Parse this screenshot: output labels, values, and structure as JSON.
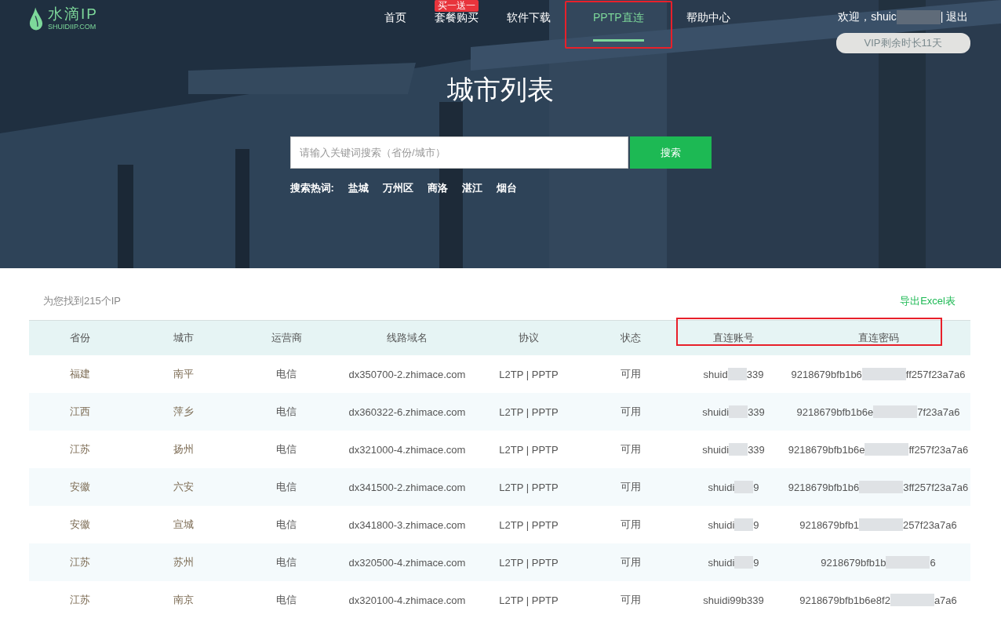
{
  "logo": {
    "name": "水滴IP",
    "domain": "SHUIDIIP.COM"
  },
  "nav": [
    {
      "label": "首页",
      "selected": false
    },
    {
      "label": "套餐购买",
      "selected": false,
      "badge": "买一送一"
    },
    {
      "label": "软件下载",
      "selected": false
    },
    {
      "label": "PPTP直连",
      "selected": true,
      "highlighted": true
    },
    {
      "label": "帮助中心",
      "selected": false
    }
  ],
  "user": {
    "greeting": "欢迎，shuic",
    "logout": "| 退出",
    "vip": "VIP剩余时长11天"
  },
  "title": "城市列表",
  "search": {
    "placeholder": "请输入关键词搜索（省份/城市）",
    "button": "搜索"
  },
  "hot_words": {
    "label": "搜索热词:",
    "items": [
      "盐城",
      "万州区",
      "商洛",
      "湛江",
      "烟台"
    ]
  },
  "result_count": "为您找到215个IP",
  "export": "导出Excel表",
  "table": {
    "columns": [
      {
        "label": "省份",
        "highlighted": false
      },
      {
        "label": "城市",
        "highlighted": false
      },
      {
        "label": "运营商",
        "highlighted": false
      },
      {
        "label": "线路域名",
        "highlighted": false
      },
      {
        "label": "协议",
        "highlighted": false
      },
      {
        "label": "状态",
        "highlighted": false
      },
      {
        "label": "直连账号",
        "highlighted": true
      },
      {
        "label": "直连密码",
        "highlighted": true
      }
    ],
    "rows": [
      {
        "province": "福建",
        "city": "南平",
        "isp": "电信",
        "domain": "dx350700-2.zhimace.com",
        "protocol": "L2TP  |  PPTP",
        "status": "可用",
        "account": [
          "shuid",
          "339"
        ],
        "password": [
          "9218679bfb1b6",
          "ff257f23a7a6"
        ]
      },
      {
        "province": "江西",
        "city": "萍乡",
        "isp": "电信",
        "domain": "dx360322-6.zhimace.com",
        "protocol": "L2TP  |  PPTP",
        "status": "可用",
        "account": [
          "shuidi",
          "339"
        ],
        "password": [
          "9218679bfb1b6e",
          "7f23a7a6"
        ]
      },
      {
        "province": "江苏",
        "city": "扬州",
        "isp": "电信",
        "domain": "dx321000-4.zhimace.com",
        "protocol": "L2TP  |  PPTP",
        "status": "可用",
        "account": [
          "shuidi",
          "339"
        ],
        "password": [
          "9218679bfb1b6e",
          "ff257f23a7a6"
        ]
      },
      {
        "province": "安徽",
        "city": "六安",
        "isp": "电信",
        "domain": "dx341500-2.zhimace.com",
        "protocol": "L2TP  |  PPTP",
        "status": "可用",
        "account": [
          "shuidi",
          "9"
        ],
        "password": [
          "9218679bfb1b6",
          "3ff257f23a7a6"
        ]
      },
      {
        "province": "安徽",
        "city": "宣城",
        "isp": "电信",
        "domain": "dx341800-3.zhimace.com",
        "protocol": "L2TP  |  PPTP",
        "status": "可用",
        "account": [
          "shuidi",
          "9"
        ],
        "password": [
          "9218679bfb1",
          "257f23a7a6"
        ]
      },
      {
        "province": "江苏",
        "city": "苏州",
        "isp": "电信",
        "domain": "dx320500-4.zhimace.com",
        "protocol": "L2TP  |  PPTP",
        "status": "可用",
        "account": [
          "shuidi",
          "9"
        ],
        "password": [
          "9218679bfb1b",
          "6"
        ]
      },
      {
        "province": "江苏",
        "city": "南京",
        "isp": "电信",
        "domain": "dx320100-4.zhimace.com",
        "protocol": "L2TP  |  PPTP",
        "status": "可用",
        "account": [
          "shuidi99b339"
        ],
        "password": [
          "9218679bfb1b6e8f2",
          "a7a6"
        ]
      }
    ]
  }
}
